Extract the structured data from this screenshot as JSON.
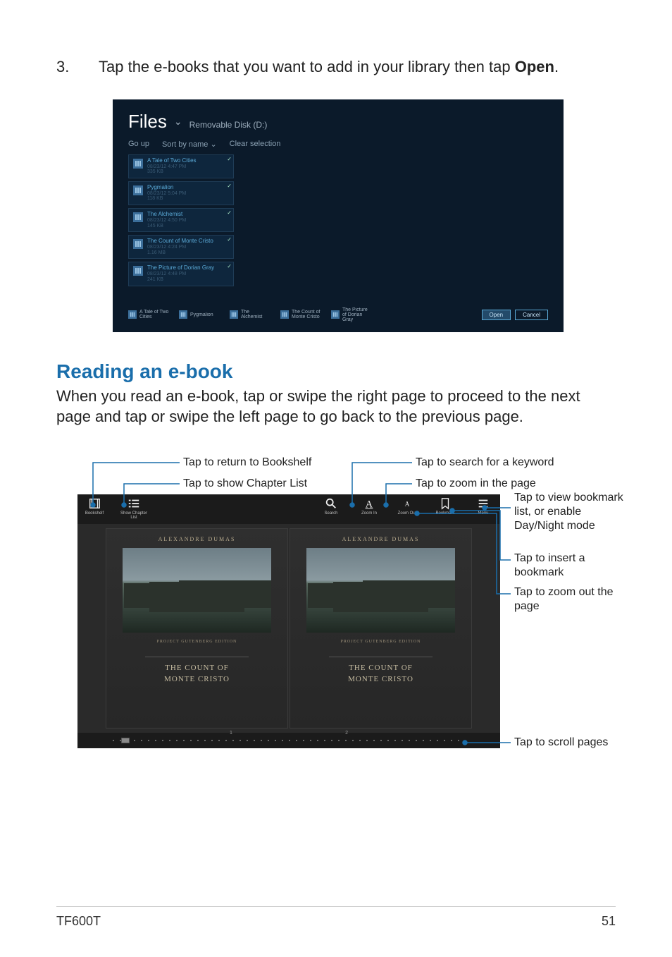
{
  "instruction": {
    "number": "3.",
    "text_prefix": "Tap the e-books that you want to add in your library then tap ",
    "text_bold": "Open",
    "text_suffix": "."
  },
  "filepicker": {
    "title": "Files",
    "subtitle": "Removable Disk (D:)",
    "go_up": "Go up",
    "sort": "Sort by name",
    "clear": "Clear selection",
    "items": [
      {
        "title": "A Tale of Two Cities",
        "date": "08/23/12 4:47 PM",
        "size": "335 KB"
      },
      {
        "title": "Pygmalion",
        "date": "08/23/12 5:04 PM",
        "size": "118 KB"
      },
      {
        "title": "The Alchemist",
        "date": "08/23/12 4:50 PM",
        "size": "145 KB"
      },
      {
        "title": "The Count of Monte Cristo",
        "date": "08/23/12 4:24 PM",
        "size": "1.16 MB"
      },
      {
        "title": "The Picture of Dorian Gray",
        "date": "08/23/12 4:48 PM",
        "size": "241 KB"
      }
    ],
    "selected": [
      {
        "label": "A Tale of Two Cities"
      },
      {
        "label": "Pygmalion"
      },
      {
        "label": "The Alchemist"
      },
      {
        "label": "The Count of Monte Cristo"
      },
      {
        "label": "The Picture of Dorian Gray"
      }
    ],
    "open_label": "Open",
    "cancel_label": "Cancel"
  },
  "section": {
    "heading": "Reading an e-book",
    "body": "When you read an e-book, tap or swipe the right page to proceed to the next page and tap or swipe the left page to go back to the previous page."
  },
  "reader": {
    "toolbar": {
      "bookshelf": "Bookshelf",
      "chapter": "Show Chapter List",
      "search": "Search",
      "zoom_in": "Zoom In",
      "zoom_out": "Zoom Out",
      "bookmark": "Bookmark",
      "menu": "Menu"
    },
    "author": "ALEXANDRE DUMAS",
    "edition": "PROJECT GUTENBERG EDITION",
    "book_title_line1": "THE COUNT OF",
    "book_title_line2": "MONTE CRISTO",
    "page_left": "1",
    "page_right": "2"
  },
  "callouts": {
    "bookshelf": "Tap to return to Bookshelf",
    "chapter": "Tap to show Chapter List",
    "search": "Tap to search for a keyword",
    "zoom_in": "Tap to zoom in the page",
    "menu": "Tap to view bookmark list, or enable Day/Night mode",
    "bookmark": "Tap to insert a bookmark",
    "zoom_out": "Tap to zoom out the page",
    "scroll": "Tap to scroll pages"
  },
  "footer": {
    "model": "TF600T",
    "page": "51"
  }
}
